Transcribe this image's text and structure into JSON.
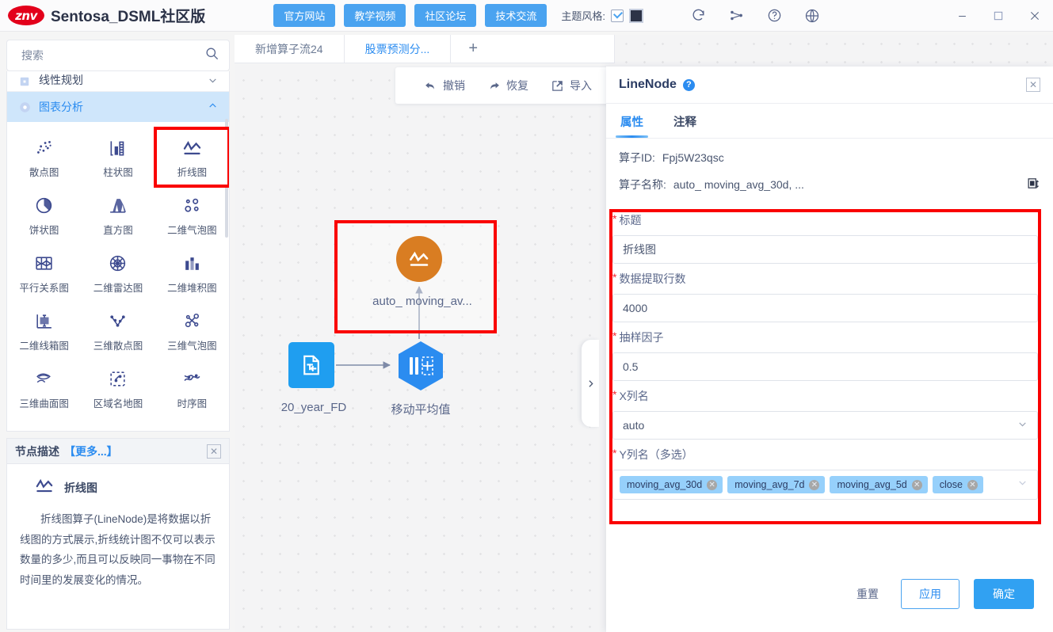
{
  "titlebar": {
    "logo_text": "znv",
    "logo_color": "#e3001b",
    "app_title": "Sentosa_DSML社区版",
    "links": [
      {
        "label": "官方网站",
        "name": "official-website-button"
      },
      {
        "label": "教学视频",
        "name": "tutorial-video-button"
      },
      {
        "label": "社区论坛",
        "name": "community-forum-button"
      },
      {
        "label": "技术交流",
        "name": "tech-exchange-button"
      }
    ],
    "theme_label": "主题风格:",
    "theme_checked": true,
    "theme_swatch_color": "#2c3347",
    "icons": [
      "refresh-icon",
      "workflow-icon",
      "help-circle-icon",
      "globe-icon"
    ],
    "window_controls": [
      "minimize-icon",
      "maximize-icon",
      "close-icon"
    ]
  },
  "sidebar": {
    "search": {
      "value": "",
      "placeholder": "搜索",
      "icon": "search-icon"
    },
    "tree": [
      {
        "label": "线性规划",
        "expanded": false,
        "active": false,
        "chevron": "chevron-down-icon"
      },
      {
        "label": "图表分析",
        "expanded": true,
        "active": true,
        "chevron": "chevron-up-icon"
      }
    ],
    "nodes": [
      {
        "label": "散点图",
        "icon": "scatter-chart-icon",
        "highlighted": false
      },
      {
        "label": "柱状图",
        "icon": "bar-chart-icon",
        "highlighted": false
      },
      {
        "label": "折线图",
        "icon": "line-chart-icon",
        "highlighted": true
      },
      {
        "label": "饼状图",
        "icon": "pie-chart-icon",
        "highlighted": false
      },
      {
        "label": "直方图",
        "icon": "histogram-icon",
        "highlighted": false
      },
      {
        "label": "二维气泡图",
        "icon": "bubble-chart-2d-icon",
        "highlighted": false
      },
      {
        "label": "平行关系图",
        "icon": "parallel-coordinates-icon",
        "highlighted": false
      },
      {
        "label": "二维雷达图",
        "icon": "radar-chart-2d-icon",
        "highlighted": false
      },
      {
        "label": "二维堆积图",
        "icon": "stacked-chart-2d-icon",
        "highlighted": false
      },
      {
        "label": "二维线箱图",
        "icon": "box-plot-2d-icon",
        "highlighted": false
      },
      {
        "label": "三维散点图",
        "icon": "scatter-chart-3d-icon",
        "highlighted": false
      },
      {
        "label": "三维气泡图",
        "icon": "bubble-chart-3d-icon",
        "highlighted": false
      },
      {
        "label": "三维曲面图",
        "icon": "surface-chart-3d-icon",
        "highlighted": false
      },
      {
        "label": "区域名地图",
        "icon": "region-map-icon",
        "highlighted": false
      },
      {
        "label": "时序图",
        "icon": "time-series-icon",
        "highlighted": false
      }
    ],
    "description": {
      "header_title": "节点描述",
      "header_more": "【更多...】",
      "close_icon": "close-icon",
      "node_icon": "line-chart-icon",
      "node_name": "折线图",
      "body": "折线图算子(LineNode)是将数据以折线图的方式展示,折线统计图不仅可以表示数量的多少,而且可以反映同一事物在不同时间里的发展变化的情况。"
    }
  },
  "canvas": {
    "tabs": [
      {
        "label": "新增算子流24",
        "active": false
      },
      {
        "label": "股票预测分...",
        "active": true
      }
    ],
    "add_tab_icon": "plus-icon",
    "toolbar": [
      {
        "label": "撤销",
        "icon": "undo-icon"
      },
      {
        "label": "恢复",
        "icon": "redo-icon"
      },
      {
        "label": "导入",
        "icon": "import-icon"
      }
    ],
    "nodes": [
      {
        "label": "20_year_FD",
        "icon": "text-import-icon",
        "shape": "square",
        "color": "#1f9ef0"
      },
      {
        "label": "移动平均值",
        "icon": "moving-average-icon",
        "shape": "hexagon",
        "color": "#2b8cf0"
      },
      {
        "label": "auto_ moving_av...",
        "icon": "line-chart-icon",
        "shape": "circle",
        "color": "#d97d22",
        "selected": true
      }
    ],
    "collapse_icon": "chevron-right-icon",
    "highlight_color": "#fa0000"
  },
  "panel": {
    "title": "LineNode",
    "help_icon": "help-circle-icon",
    "close_icon": "close-icon",
    "tabs": [
      {
        "label": "属性",
        "active": true
      },
      {
        "label": "注释",
        "active": false
      }
    ],
    "meta": [
      {
        "key": "算子ID:",
        "value": "Fpj5W23qsc"
      },
      {
        "key": "算子名称:",
        "value": "auto_ moving_avg_30d, ...",
        "copy_icon": "copy-icon"
      }
    ],
    "fields": [
      {
        "name": "title",
        "label": "标题",
        "required": true,
        "type": "input",
        "value": "折线图"
      },
      {
        "name": "row-count",
        "label": "数据提取行数",
        "required": true,
        "type": "input",
        "value": "4000"
      },
      {
        "name": "sampling-factor",
        "label": "抽样因子",
        "required": true,
        "type": "input",
        "value": "0.5"
      },
      {
        "name": "x-column",
        "label": "X列名",
        "required": true,
        "type": "select",
        "value": "auto"
      },
      {
        "name": "y-columns",
        "label": "Y列名（多选）",
        "required": true,
        "type": "tags",
        "tags": [
          "moving_avg_30d",
          "moving_avg_7d",
          "moving_avg_5d",
          "close"
        ]
      }
    ],
    "footer": {
      "reset": "重置",
      "apply": "应用",
      "confirm": "确定"
    },
    "highlight_color": "#fa0000"
  }
}
